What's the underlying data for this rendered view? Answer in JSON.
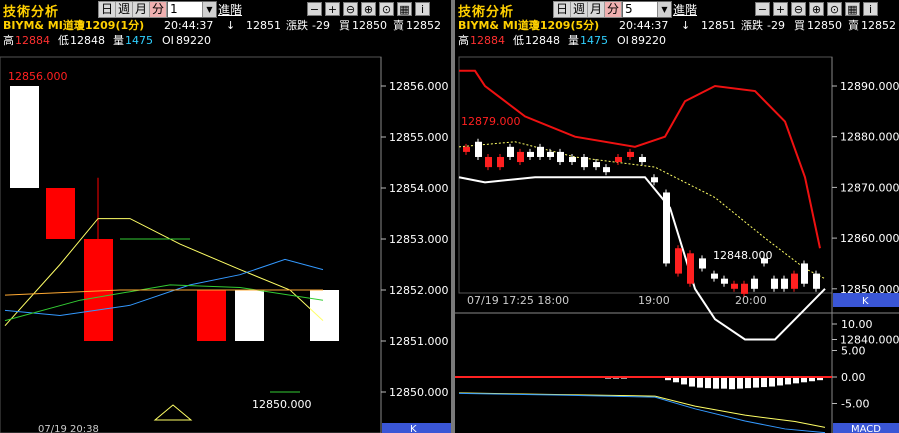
{
  "left": {
    "title": "技術分析",
    "period_buttons": [
      "日",
      "週",
      "月",
      "分"
    ],
    "active_period": "分",
    "interval_value": "1",
    "advanced_label": "進階",
    "toolbar_icons": [
      "minus-icon",
      "plus-icon",
      "zoom-out-icon",
      "zoom-in-icon",
      "zoom-fit-icon",
      "calendar-icon",
      "info-icon"
    ],
    "symbol": "BIYM& MI道瓊1209(1分)",
    "time": "20:44:37",
    "arrow": "↓",
    "last": "12851",
    "change_label": "漲跌",
    "change": "-29",
    "bid_label": "買",
    "bid": "12850",
    "ask_label": "賣",
    "ask": "12852",
    "high_label": "高",
    "high": "12884",
    "low_label": "低",
    "low": "12848",
    "vol_label": "量",
    "vol": "1475",
    "oi_label": "OI",
    "oi": "89220",
    "max_marker": "12856.000",
    "min_marker": "12850.000",
    "x_label": "07/19 20:38",
    "corner_label": "K",
    "y_ticks": [
      "12856.000",
      "12855.000",
      "12854.000",
      "12853.000",
      "12852.000",
      "12851.000",
      "12850.000"
    ],
    "colors": {
      "up": "#ffffff",
      "down": "#ff0000",
      "ma5": "#ffff66",
      "ma10": "#3399ff",
      "ma20": "#33cc33",
      "ma60": "#ffaa33"
    }
  },
  "right": {
    "title": "技術分析",
    "period_buttons": [
      "日",
      "週",
      "月",
      "分"
    ],
    "active_period": "分",
    "interval_value": "5",
    "advanced_label": "進階",
    "toolbar_icons": [
      "minus-icon",
      "plus-icon",
      "zoom-out-icon",
      "zoom-in-icon",
      "zoom-fit-icon",
      "calendar-icon",
      "info-icon"
    ],
    "symbol": "BIYM& MI道瓊1209(5分)",
    "time": "20:44:37",
    "arrow": "↓",
    "last": "12851",
    "change_label": "漲跌",
    "change": "-29",
    "bid_label": "買",
    "bid": "12850",
    "ask_label": "賣",
    "ask": "12852",
    "high_label": "高",
    "high": "12884",
    "low_label": "低",
    "low": "12848",
    "vol_label": "量",
    "vol": "1475",
    "oi_label": "OI",
    "oi": "89220",
    "max_marker": "12879.000",
    "min_marker": "12848.000",
    "x_labels": [
      "07/19 17:25 18:00",
      "19:00",
      "20:00"
    ],
    "corner_label": "K",
    "y_ticks": [
      "12890.000",
      "12880.000",
      "12870.000",
      "12860.000",
      "12850.000",
      "12840.000"
    ],
    "macd_ticks": [
      "10.00",
      "5.00",
      "0.00",
      "-5.00"
    ],
    "macd_label": "MACD",
    "colors": {
      "upper_band": "#ee1111",
      "lower_band": "#ffffff",
      "mid": "#ffff66",
      "dif": "#ffff66",
      "dea": "#3399ff",
      "hist": "#ffffff",
      "zero": "#ff2222"
    }
  }
}
